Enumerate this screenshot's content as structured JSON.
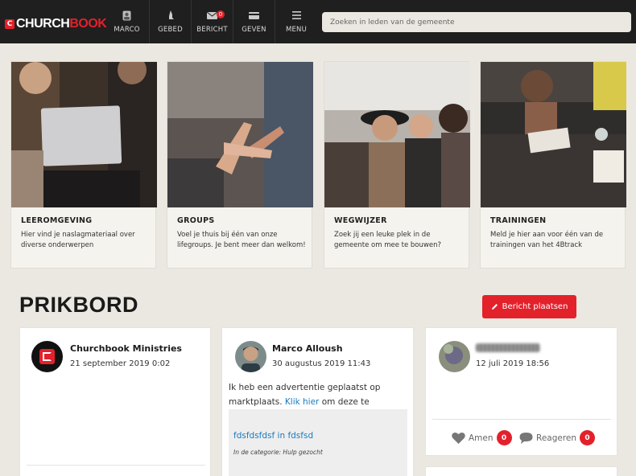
{
  "brand": {
    "logo_part1": "CHURCH",
    "logo_part2": "BOOK",
    "logo_mark": "C"
  },
  "nav": [
    {
      "label": "MARCO",
      "icon": "avatar-icon"
    },
    {
      "label": "GEBED",
      "icon": "praying-hands-icon"
    },
    {
      "label": "BERICHT",
      "icon": "envelope-icon",
      "badge": "0"
    },
    {
      "label": "GEVEN",
      "icon": "credit-card-icon"
    },
    {
      "label": "MENU",
      "icon": "hamburger-icon"
    }
  ],
  "search": {
    "placeholder": "Zoeken in leden van de gemeente"
  },
  "cards": [
    {
      "title": "LEEROMGEVING",
      "desc": "Hier vind je naslagmateriaal over diverse onderwerpen"
    },
    {
      "title": "GROUPS",
      "desc": "Voel je thuis bij één van onze lifegroups. Je bent meer dan welkom!"
    },
    {
      "title": "WEGWIJZER",
      "desc": "Zoek jij een leuke plek in de gemeente om mee te bouwen?"
    },
    {
      "title": "TRAININGEN",
      "desc": "Meld je hier aan voor één van de trainingen van het 4Btrack"
    }
  ],
  "prikbord": {
    "title": "PRIKBORD",
    "post_button": "Bericht plaatsen",
    "posts": [
      {
        "name": "Churchbook Ministries",
        "date": "21 september 2019 0:02"
      },
      {
        "name": "Marco Alloush",
        "date": "30 augustus 2019 11:43",
        "text_before": "Ik heb een advertentie geplaatst op marktplaats. ",
        "link": "Klik hier",
        "text_after": " om deze te bekijken.",
        "embed_title": "fdsfdsfdsf in fdsfsd",
        "embed_category": "In de categorie: Hulp gezocht"
      },
      {
        "name": "",
        "date": "12 juli 2019 18:56",
        "amen_label": "Amen",
        "amen_count": "0",
        "react_label": "Reageren",
        "react_count": "0"
      }
    ]
  },
  "colors": {
    "accent": "#e3212b",
    "topbar": "#1f1f1f",
    "background": "#ebe8e1",
    "link": "#1a7bbf"
  }
}
